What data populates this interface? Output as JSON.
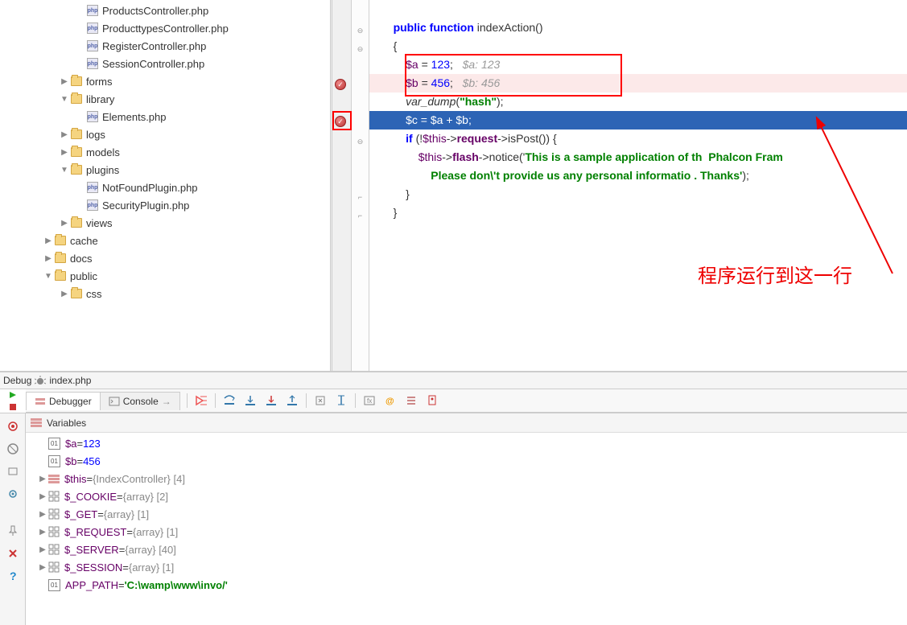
{
  "tree": {
    "items": [
      {
        "indent": 3,
        "type": "php",
        "label": "ProductsController.php",
        "partial": true
      },
      {
        "indent": 3,
        "type": "php",
        "label": "ProducttypesController.php"
      },
      {
        "indent": 3,
        "type": "php",
        "label": "RegisterController.php"
      },
      {
        "indent": 3,
        "type": "php",
        "label": "SessionController.php"
      },
      {
        "indent": 2,
        "type": "folder",
        "label": "forms",
        "expand": "▶"
      },
      {
        "indent": 2,
        "type": "folder",
        "label": "library",
        "expand": "▼"
      },
      {
        "indent": 3,
        "type": "php",
        "label": "Elements.php"
      },
      {
        "indent": 2,
        "type": "folder",
        "label": "logs",
        "expand": "▶"
      },
      {
        "indent": 2,
        "type": "folder",
        "label": "models",
        "expand": "▶"
      },
      {
        "indent": 2,
        "type": "folder",
        "label": "plugins",
        "expand": "▼"
      },
      {
        "indent": 3,
        "type": "php",
        "label": "NotFoundPlugin.php"
      },
      {
        "indent": 3,
        "type": "php",
        "label": "SecurityPlugin.php"
      },
      {
        "indent": 2,
        "type": "folder",
        "label": "views",
        "expand": "▶"
      },
      {
        "indent": 1,
        "type": "folder",
        "label": "cache",
        "expand": "▶"
      },
      {
        "indent": 1,
        "type": "folder",
        "label": "docs",
        "expand": "▶"
      },
      {
        "indent": 1,
        "type": "folder",
        "label": "public",
        "expand": "▼"
      },
      {
        "indent": 2,
        "type": "folder",
        "label": "css",
        "expand": "▶"
      }
    ]
  },
  "editor": {
    "lines": {
      "fn_decl_public": "public function",
      "fn_decl_name": " indexAction()",
      "brace_open": "{",
      "a_assign_var": "$a",
      "a_assign_eq": " = ",
      "a_assign_val": "123",
      "a_comment": "   $a: 123",
      "b_assign_var": "$b",
      "b_assign_eq": " = ",
      "b_assign_val": "456",
      "b_comment": "   $b: 456",
      "vardump": "var_dump",
      "vardump_arg": "\"hash\"",
      "c_line": "$c = $a + $b;",
      "if_kw": "if",
      "if_cond_1": " (!",
      "if_this": "$this",
      "if_arrow": "->",
      "if_req": "request",
      "if_ispost": "->isPost()) {",
      "flash_this": "$this",
      "flash_arrow": "->",
      "flash_prop": "flash",
      "flash_notice": "->notice('",
      "flash_str1": "This is a sample application of th  Phalcon Fram",
      "flash_str2": "Please don\\'t provide us any personal informatio . Thanks'",
      "flash_end": ");",
      "close1": "}",
      "close2": "}"
    },
    "annotation_text": "程序运行到这一行"
  },
  "debug": {
    "title_prefix": "Debug",
    "title_file": "index.php",
    "tabs": {
      "debugger": "Debugger",
      "console": "Console",
      "console_suffix": "→"
    },
    "vars_header": "Variables",
    "variables": [
      {
        "icon": "num",
        "name": "$a",
        "eq": " = ",
        "value": "123",
        "valtype": "num",
        "expand": ""
      },
      {
        "icon": "num",
        "name": "$b",
        "eq": " = ",
        "value": "456",
        "valtype": "num",
        "expand": ""
      },
      {
        "icon": "obj",
        "name": "$this",
        "eq": " = ",
        "value": "{IndexController} [4]",
        "valtype": "gray",
        "expand": "▶"
      },
      {
        "icon": "arr",
        "name": "$_COOKIE",
        "eq": " = ",
        "value": "{array} [2]",
        "valtype": "gray",
        "expand": "▶"
      },
      {
        "icon": "arr",
        "name": "$_GET",
        "eq": " = ",
        "value": "{array} [1]",
        "valtype": "gray",
        "expand": "▶"
      },
      {
        "icon": "arr",
        "name": "$_REQUEST",
        "eq": " = ",
        "value": "{array} [1]",
        "valtype": "gray",
        "expand": "▶"
      },
      {
        "icon": "arr",
        "name": "$_SERVER",
        "eq": " = ",
        "value": "{array} [40]",
        "valtype": "gray",
        "expand": "▶"
      },
      {
        "icon": "arr",
        "name": "$_SESSION",
        "eq": " = ",
        "value": "{array} [1]",
        "valtype": "gray",
        "expand": "▶"
      },
      {
        "icon": "num",
        "name": "APP_PATH",
        "eq": " = ",
        "value": "'C:\\wamp\\www\\invo/'",
        "valtype": "str",
        "expand": ""
      }
    ]
  }
}
